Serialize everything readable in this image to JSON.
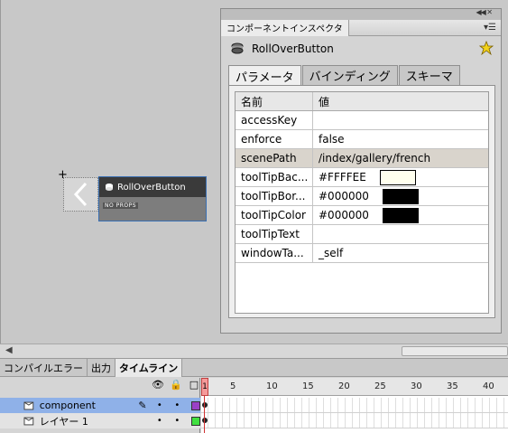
{
  "stage": {
    "symbol_label": "RollOverButton",
    "symbol_note": "NO PROPS"
  },
  "inspector": {
    "panel_tab": "コンポーネントインスペクタ",
    "component_name": "RollOverButton",
    "tabs": [
      "パラメータ",
      "バインディング",
      "スキーマ"
    ],
    "active_tab": "パラメータ",
    "grid_header": {
      "name": "名前",
      "value": "値"
    },
    "rows": [
      {
        "name": "accessKey",
        "value": ""
      },
      {
        "name": "enforce",
        "value": "false"
      },
      {
        "name": "scenePath",
        "value": "/index/gallery/french"
      },
      {
        "name": "toolTipBac...",
        "value": "#FFFFEE",
        "swatch": "#FFFFEE"
      },
      {
        "name": "toolTipBor...",
        "value": "#000000",
        "swatch": "#000000"
      },
      {
        "name": "toolTipColor",
        "value": "#000000",
        "swatch": "#000000"
      },
      {
        "name": "toolTipText",
        "value": ""
      },
      {
        "name": "windowTa...",
        "value": "_self"
      }
    ],
    "selected_row": "scenePath"
  },
  "timeline": {
    "tabs": [
      "コンパイルエラー",
      "出力",
      "タイムライン"
    ],
    "active_tab": "タイムライン",
    "current_frame": "1",
    "ruler": [
      "5",
      "10",
      "15",
      "20",
      "25",
      "30",
      "35",
      "40"
    ],
    "layers": [
      {
        "name": "component",
        "color": "#9a40c8",
        "selected": true
      },
      {
        "name": "レイヤー 1",
        "color": "#40e040",
        "selected": false
      }
    ]
  },
  "colors": {
    "selection_blue": "#8fb1e8",
    "playhead": "#f59a9a"
  }
}
